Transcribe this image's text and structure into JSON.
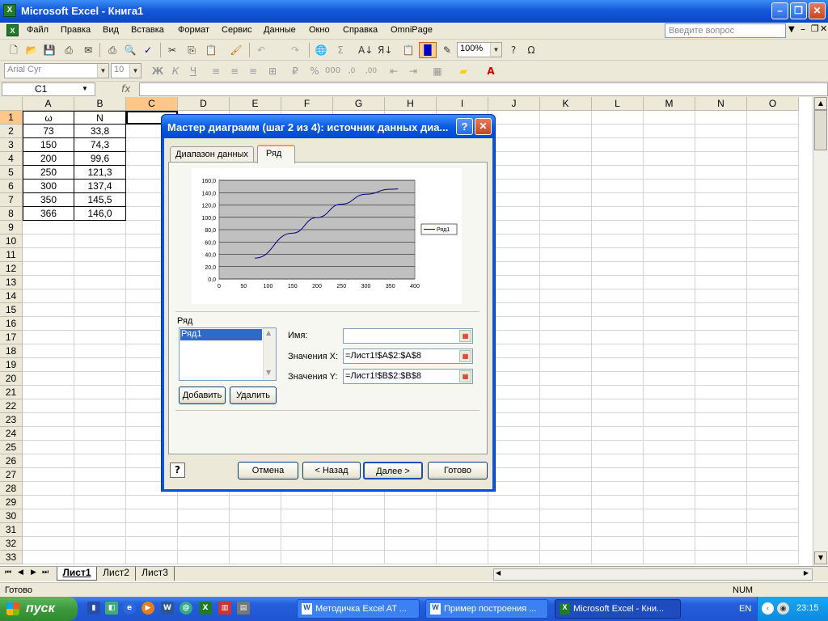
{
  "window": {
    "title": "Microsoft Excel - Книга1"
  },
  "menu": [
    "Файл",
    "Правка",
    "Вид",
    "Вставка",
    "Формат",
    "Сервис",
    "Данные",
    "Окно",
    "Справка",
    "OmniPage"
  ],
  "help_placeholder": "Введите вопрос",
  "toolbar": {
    "zoom": "100%",
    "font": "Arial Cyr",
    "size": "10"
  },
  "namebox": "C1",
  "fx": "fx",
  "columns": [
    "A",
    "B",
    "C",
    "D",
    "E",
    "F",
    "G",
    "H",
    "I",
    "J",
    "K",
    "L",
    "M",
    "N",
    "O"
  ],
  "rows": [
    "1",
    "2",
    "3",
    "4",
    "5",
    "6",
    "7",
    "8",
    "9",
    "10",
    "11",
    "12",
    "13",
    "14",
    "15",
    "16",
    "17",
    "18",
    "19",
    "20",
    "21",
    "22",
    "23",
    "24",
    "25",
    "26",
    "27",
    "28",
    "29",
    "30",
    "31",
    "32",
    "33"
  ],
  "cells": [
    [
      "ω",
      "N"
    ],
    [
      "73",
      "33,8"
    ],
    [
      "150",
      "74,3"
    ],
    [
      "200",
      "99,6"
    ],
    [
      "250",
      "121,3"
    ],
    [
      "300",
      "137,4"
    ],
    [
      "350",
      "145,5"
    ],
    [
      "366",
      "146,0"
    ]
  ],
  "dialog": {
    "title": "Мастер диаграмм (шаг 2 из 4): источник данных диа...",
    "help_btn": "?",
    "tabs": [
      "Диапазон данных",
      "Ряд"
    ],
    "series_label": "Ряд",
    "series_list": [
      "Ряд1"
    ],
    "add_button": "Добавить",
    "delete_button": "Удалить",
    "name_label": "Имя:",
    "name_value": "",
    "x_label": "Значения X:",
    "x_value": "=Лист1!$A$2:$A$8",
    "y_label": "Значения Y:",
    "y_value": "=Лист1!$B$2:$B$8",
    "cancel": "Отмена",
    "back": "< Назад",
    "next": "Далее >",
    "finish": "Готово"
  },
  "chart_data": {
    "type": "scatter",
    "x": [
      73,
      150,
      200,
      250,
      300,
      350,
      366
    ],
    "series": [
      {
        "name": "Ряд1",
        "values": [
          33.8,
          74.3,
          99.6,
          121.3,
          137.4,
          145.5,
          146.0
        ]
      }
    ],
    "xlim": [
      0,
      400
    ],
    "ylim": [
      0,
      160
    ],
    "xticks": [
      "0",
      "50",
      "100",
      "150",
      "200",
      "250",
      "300",
      "350",
      "400"
    ],
    "yticks": [
      "0,0",
      "20,0",
      "40,0",
      "60,0",
      "80,0",
      "100,0",
      "120,0",
      "140,0",
      "160,0"
    ],
    "legend": "right",
    "grid": true,
    "colors": {
      "plot_bg": "#c0c0c0",
      "line": "#000080"
    }
  },
  "sheets": [
    "Лист1",
    "Лист2",
    "Лист3"
  ],
  "status": {
    "left": "Готово",
    "num": "NUM"
  },
  "taskbar": {
    "start": "пуск",
    "tasks": [
      "Методичка Excel AT ...",
      "Пример построения ...",
      "Microsoft Excel - Кни..."
    ],
    "lang": "EN",
    "clock": "23:15"
  }
}
